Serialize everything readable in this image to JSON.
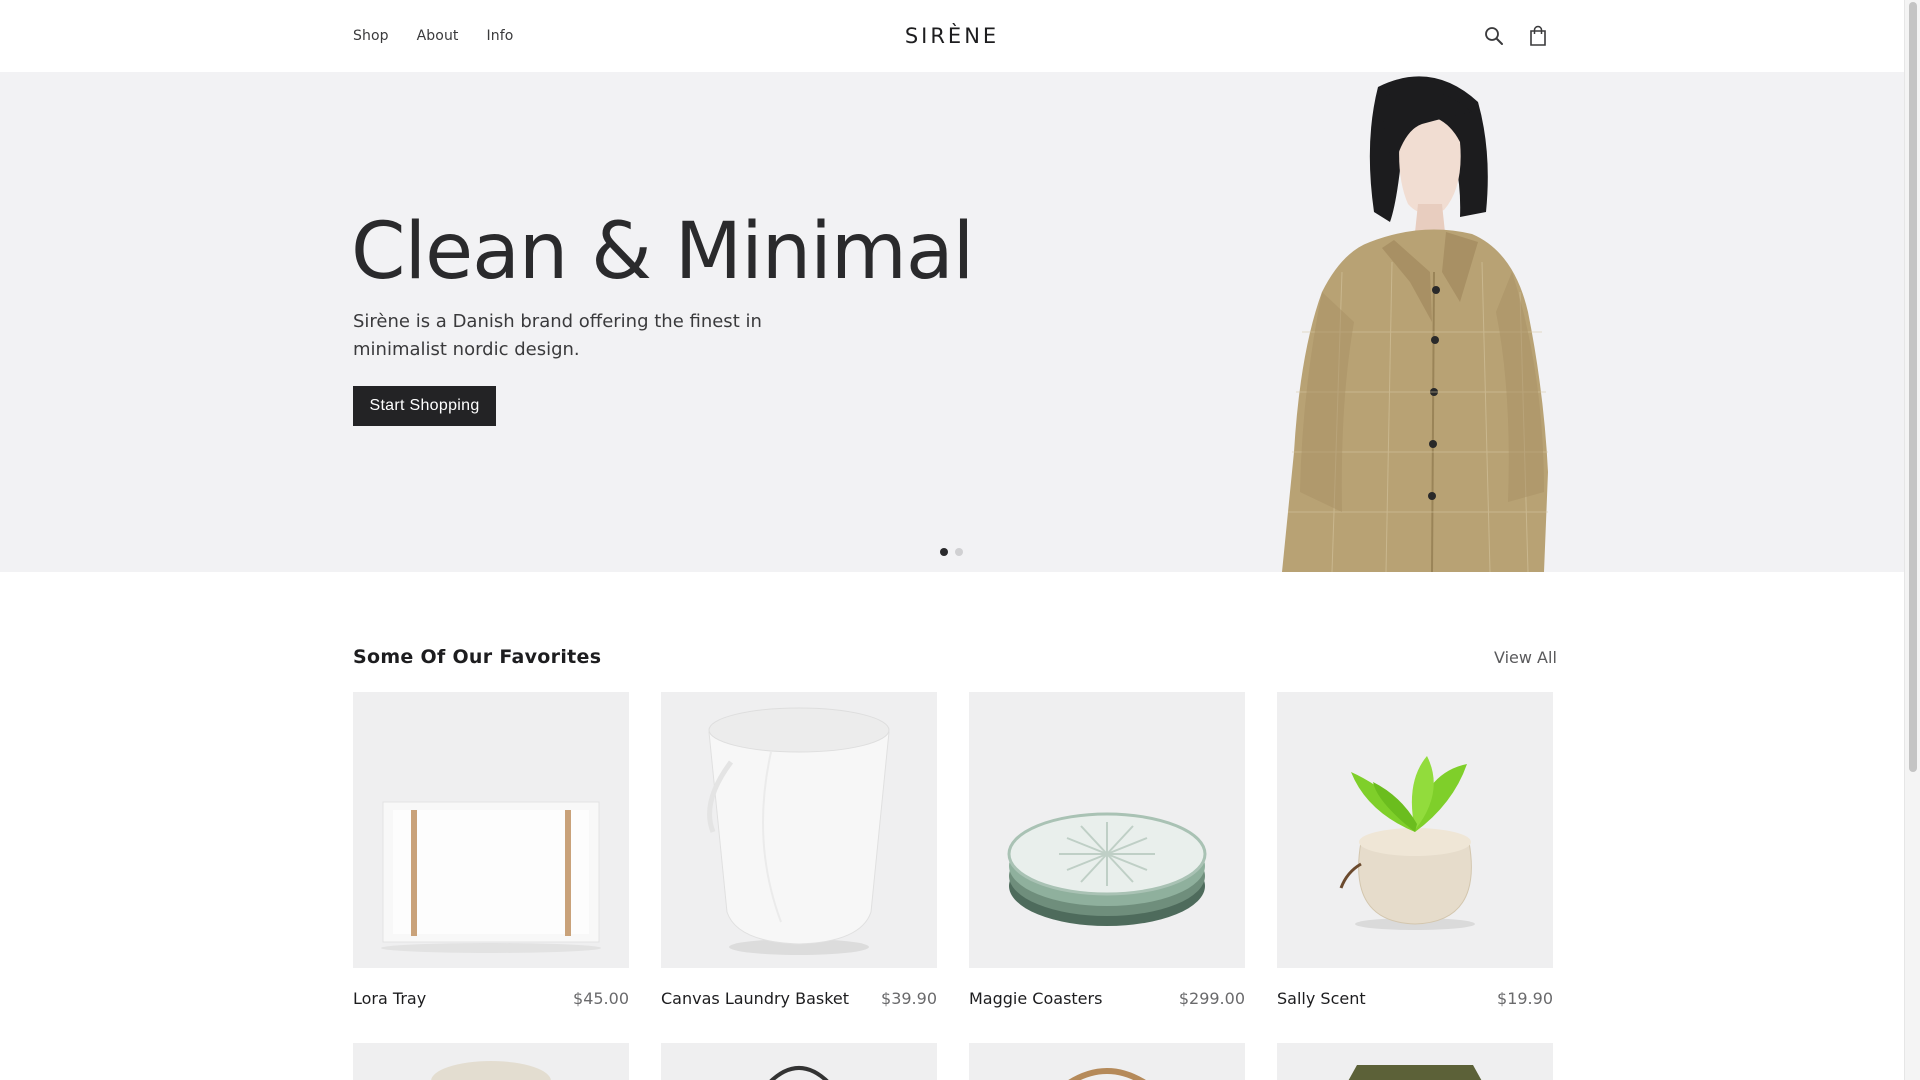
{
  "header": {
    "nav": [
      "Shop",
      "About",
      "Info"
    ],
    "logo": "SIRÈNE",
    "icons": [
      "search-icon",
      "shopping-bag-icon"
    ]
  },
  "hero": {
    "title": "Clean & Minimal",
    "subtitle": "Sirène is a Danish brand offering the finest in minimalist nordic design.",
    "button": "Start Shopping",
    "slides_total": 2,
    "active_slide": 1
  },
  "favorites": {
    "title": "Some Of Our Favorites",
    "view_all": "View All",
    "products": [
      {
        "name": "Lora Tray",
        "price": "$45.00"
      },
      {
        "name": "Canvas Laundry Basket",
        "price": "$39.90"
      },
      {
        "name": "Maggie Coasters",
        "price": "$299.00"
      },
      {
        "name": "Sally Scent",
        "price": "$19.90"
      }
    ]
  },
  "colors": {
    "hero_bg": "#f2f2f4",
    "button_bg": "#232325",
    "product_bg": "#efeff0",
    "jacket": "#b8a274"
  }
}
